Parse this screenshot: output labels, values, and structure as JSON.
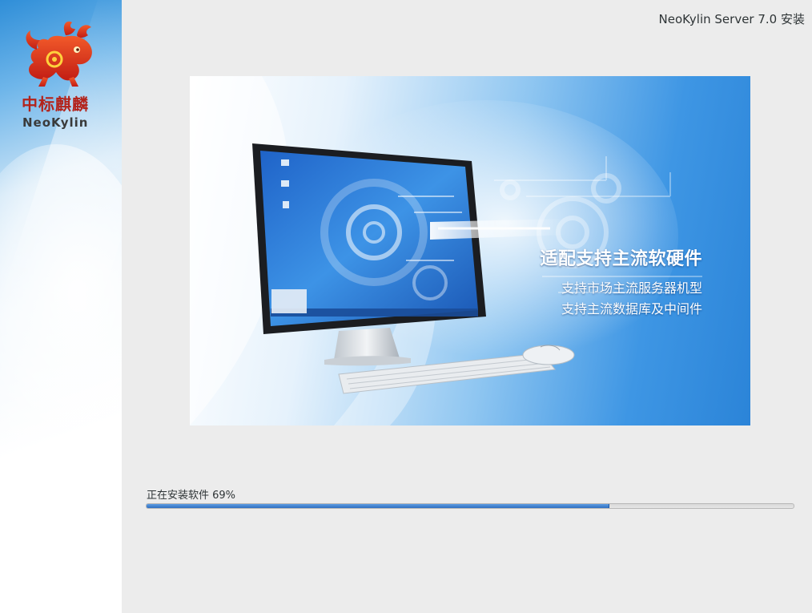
{
  "window": {
    "title": "NeoKylin Server 7.0 安装"
  },
  "sidebar": {
    "logo": {
      "icon": "qilin-logo-icon",
      "name_cn": "中标麒麟",
      "name_en": "NeoKylin"
    }
  },
  "banner": {
    "headline": "适配支持主流软硬件",
    "line1": "支持市场主流服务器机型",
    "line2": "支持主流数据库及中间件"
  },
  "progress": {
    "label": "正在安装软件 69%",
    "fraction": 0.715
  },
  "colors": {
    "accent": "#3a7bd5",
    "logo_red": "#b3231b",
    "background": "#ececec"
  }
}
